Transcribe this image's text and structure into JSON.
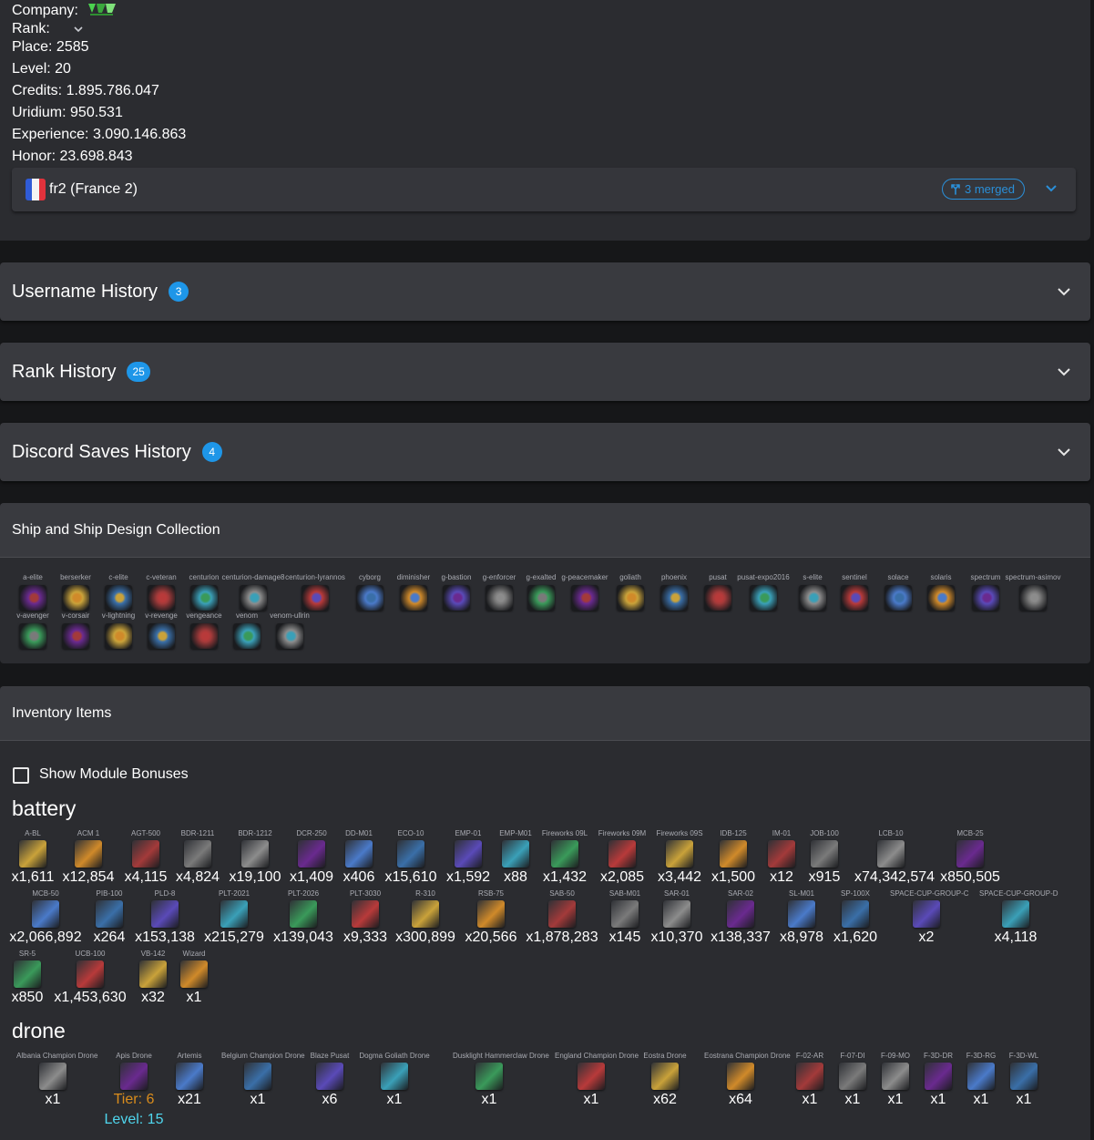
{
  "profile": {
    "company_label": "Company:",
    "company_logo": "VRU",
    "rank_label": "Rank:",
    "place_label": "Place:",
    "place": "2585",
    "level_label": "Level:",
    "level": "20",
    "credits_label": "Credits:",
    "credits": "1.895.786.047",
    "uridium_label": "Uridium:",
    "uridium": "950.531",
    "experience_label": "Experience:",
    "experience": "3.090.146.863",
    "honor_label": "Honor:",
    "honor": "23.698.843",
    "server": "fr2 (France 2)",
    "merged": "3 merged"
  },
  "sections": {
    "username_history": {
      "title": "Username History",
      "count": "3"
    },
    "rank_history": {
      "title": "Rank History",
      "count": "25"
    },
    "discord_history": {
      "title": "Discord Saves History",
      "count": "4"
    }
  },
  "ships": {
    "title": "Ship and Ship Design Collection",
    "items": [
      "a-elite",
      "berserker",
      "c-elite",
      "c-veteran",
      "centurion",
      "centurion-damage8",
      "centurion-lyrannos",
      "cyborg",
      "diminisher",
      "g-bastion",
      "g-enforcer",
      "g-exalted",
      "g-peacemaker",
      "goliath",
      "phoenix",
      "pusat",
      "pusat-expo2016",
      "s-elite",
      "sentinel",
      "solace",
      "solaris",
      "spectrum",
      "spectrum-asimov",
      "v-avenger",
      "v-corsair",
      "v-lightning",
      "v-revenge",
      "vengeance",
      "venom",
      "venom-ullrin"
    ]
  },
  "inventory": {
    "title": "Inventory Items",
    "show_bonuses": "Show Module Bonuses",
    "battery_title": "battery",
    "battery": [
      {
        "name": "A-BL",
        "qty": "x1,611"
      },
      {
        "name": "ACM 1",
        "qty": "x12,854"
      },
      {
        "name": "AGT-500",
        "qty": "x4,115"
      },
      {
        "name": "BDR-1211",
        "qty": "x4,824"
      },
      {
        "name": "BDR-1212",
        "qty": "x19,100"
      },
      {
        "name": "DCR-250",
        "qty": "x1,409"
      },
      {
        "name": "DD-M01",
        "qty": "x406"
      },
      {
        "name": "ECO-10",
        "qty": "x15,610"
      },
      {
        "name": "EMP-01",
        "qty": "x1,592"
      },
      {
        "name": "EMP-M01",
        "qty": "x88"
      },
      {
        "name": "Fireworks 09L",
        "qty": "x1,432"
      },
      {
        "name": "Fireworks 09M",
        "qty": "x2,085"
      },
      {
        "name": "Fireworks 09S",
        "qty": "x3,442"
      },
      {
        "name": "IDB-125",
        "qty": "x1,500"
      },
      {
        "name": "IM-01",
        "qty": "x12"
      },
      {
        "name": "JOB-100",
        "qty": "x915"
      },
      {
        "name": "LCB-10",
        "qty": "x74,342,574"
      },
      {
        "name": "MCB-25",
        "qty": "x850,505"
      },
      {
        "name": "MCB-50",
        "qty": "x2,066,892"
      },
      {
        "name": "PIB-100",
        "qty": "x264"
      },
      {
        "name": "PLD-8",
        "qty": "x153,138"
      },
      {
        "name": "PLT-2021",
        "qty": "x215,279"
      },
      {
        "name": "PLT-2026",
        "qty": "x139,043"
      },
      {
        "name": "PLT-3030",
        "qty": "x9,333"
      },
      {
        "name": "R-310",
        "qty": "x300,899"
      },
      {
        "name": "RSB-75",
        "qty": "x20,566"
      },
      {
        "name": "SAB-50",
        "qty": "x1,878,283"
      },
      {
        "name": "SAB-M01",
        "qty": "x145"
      },
      {
        "name": "SAR-01",
        "qty": "x10,370"
      },
      {
        "name": "SAR-02",
        "qty": "x138,337"
      },
      {
        "name": "SL-M01",
        "qty": "x8,978"
      },
      {
        "name": "SP-100X",
        "qty": "x1,620"
      },
      {
        "name": "SPACE-CUP-GROUP-C",
        "qty": "x2"
      },
      {
        "name": "SPACE-CUP-GROUP-D",
        "qty": "x4,118"
      },
      {
        "name": "SR-5",
        "qty": "x850"
      },
      {
        "name": "UCB-100",
        "qty": "x1,453,630"
      },
      {
        "name": "VB-142",
        "qty": "x32"
      },
      {
        "name": "Wizard",
        "qty": "x1"
      }
    ],
    "drone_title": "drone",
    "drones": [
      {
        "name": "Albania Champion Drone",
        "qty": "x1"
      },
      {
        "name": "Apis Drone",
        "qty": "",
        "tier": "Tier: 6",
        "level": "Level: 15"
      },
      {
        "name": "Artemis",
        "qty": "x21"
      },
      {
        "name": "Belgium Champion Drone",
        "qty": "x1"
      },
      {
        "name": "Blaze Pusat",
        "qty": "x6"
      },
      {
        "name": "Dogma Goliath Drone",
        "qty": "x1"
      },
      {
        "name": "Dusklight Hammerclaw Drone",
        "qty": "x1"
      },
      {
        "name": "England Champion Drone",
        "qty": "x1"
      },
      {
        "name": "Eostra Drone",
        "qty": "x62"
      },
      {
        "name": "Eostrana Champion Drone",
        "qty": "x64"
      },
      {
        "name": "F-02-AR",
        "qty": "x1"
      },
      {
        "name": "F-07-DI",
        "qty": "x1"
      },
      {
        "name": "F-09-MO",
        "qty": "x1"
      },
      {
        "name": "F-3D-DR",
        "qty": "x1"
      },
      {
        "name": "F-3D-RG",
        "qty": "x1"
      },
      {
        "name": "F-3D-WL",
        "qty": "x1"
      }
    ]
  },
  "colors": {
    "page_bg": "#161719",
    "card_bg": "#2b2c30",
    "header_bg": "#393a3f",
    "accent": "#1e96e8",
    "tier": "#d98c1c",
    "level": "#4fd6ee"
  },
  "icons": {
    "server_toggle": "chevron-down-icon",
    "merged": "merge-icon",
    "flag": "france-flag-icon",
    "section_toggle": "chevron-down-icon"
  }
}
